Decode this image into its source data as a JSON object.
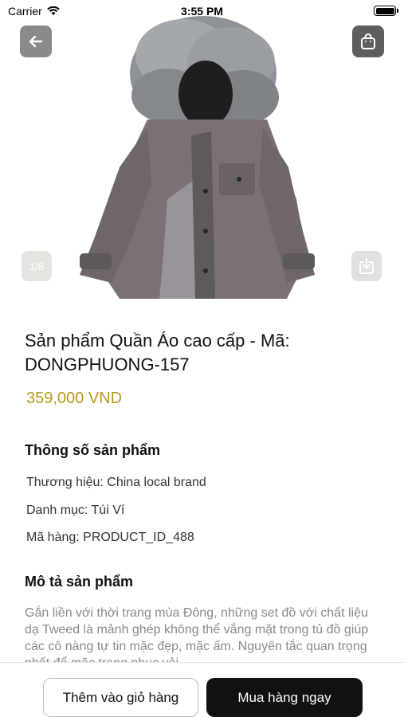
{
  "status_bar": {
    "carrier": "Carrier",
    "time": "3:55 PM",
    "wifi_icon": "wifi-icon",
    "battery_icon": "battery-icon"
  },
  "gallery": {
    "page_indicator": "1/8",
    "back_icon": "arrow-left-icon",
    "bag_icon": "shopping-bag-icon",
    "download_icon": "download-icon"
  },
  "product": {
    "title": "Sản phẩm Quần Áo cao cấp - Mã: DONGPHUONG-157",
    "price": "359,000 VND",
    "price_color": "#b59a18"
  },
  "specs": {
    "heading": "Thông số sản phẩm",
    "brand": "Thương hiệu: China local brand",
    "category": "Danh mục: Túi Ví",
    "sku": "Mã hàng: PRODUCT_ID_488"
  },
  "description": {
    "heading": "Mô tả sản phẩm",
    "text": "Gắn liền với thời trang mùa Đông, những set đồ với chất liệu dạ Tweed là mảnh ghép không thể vắng mặt trong tủ đồ giúp các cô nàng tự tin mặc đẹp, mặc ấm. Nguyên tắc quan trọng nhất để mặc trang phục vải"
  },
  "actions": {
    "add_to_cart": "Thêm vào giỏ hàng",
    "buy_now": "Mua hàng ngay"
  }
}
